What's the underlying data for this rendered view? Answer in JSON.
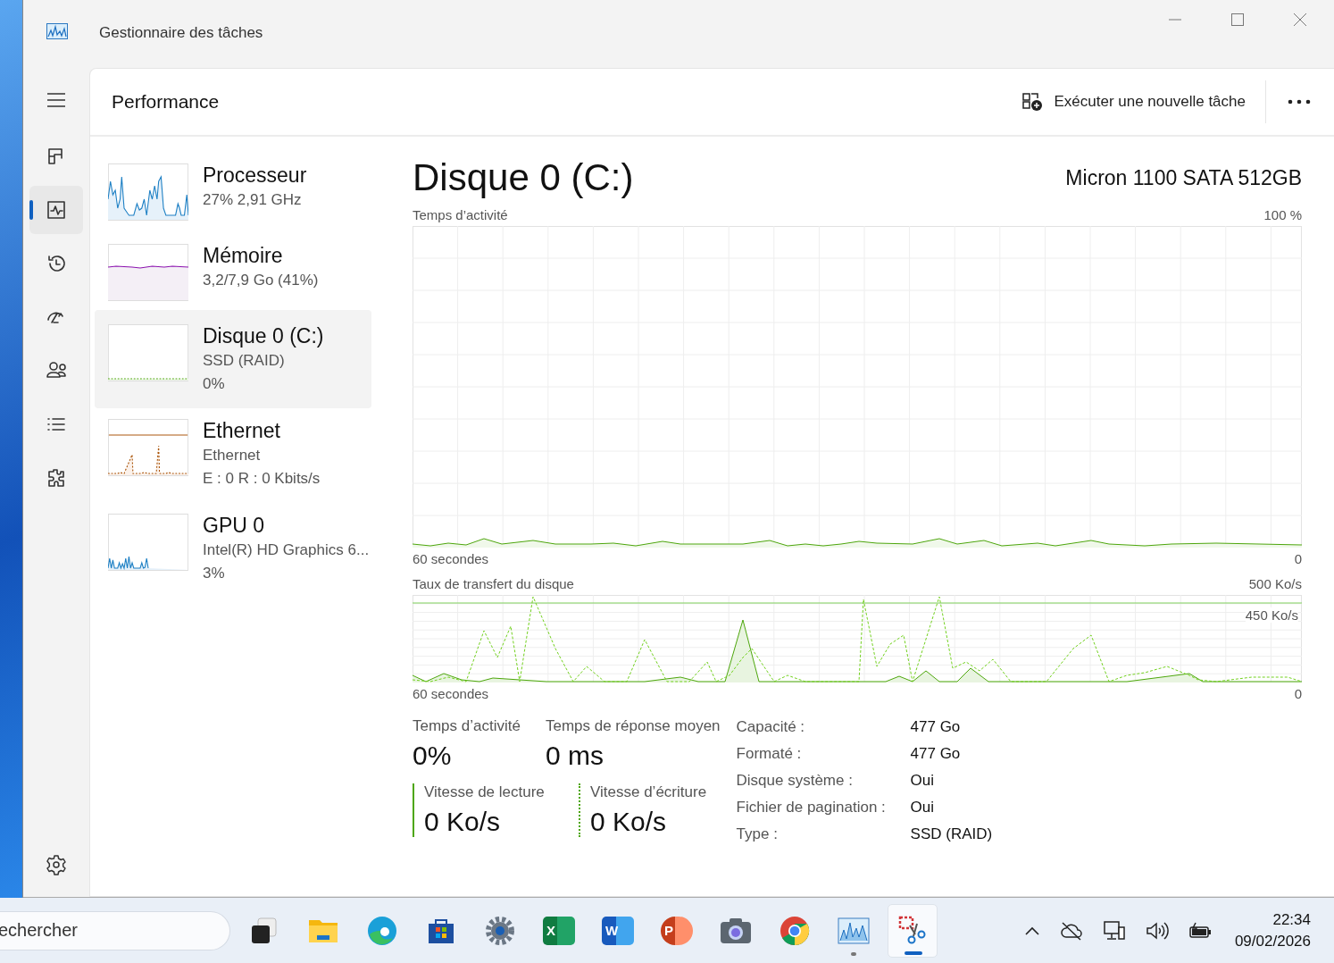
{
  "window": {
    "title": "Gestionnaire des tâches"
  },
  "nav_items": [
    {
      "kind": "processes",
      "selected": false
    },
    {
      "kind": "performance",
      "selected": true
    },
    {
      "kind": "history",
      "selected": false
    },
    {
      "kind": "startup",
      "selected": false
    },
    {
      "kind": "users",
      "selected": false
    },
    {
      "kind": "details",
      "selected": false
    },
    {
      "kind": "services",
      "selected": false
    }
  ],
  "page": {
    "title": "Performance",
    "run_task": "Exécuter une nouvelle tâche"
  },
  "resources": [
    {
      "kind": "cpu",
      "name": "Processeur",
      "lines": [
        "27%  2,91 GHz"
      ],
      "selected": false
    },
    {
      "kind": "memory",
      "name": "Mémoire",
      "lines": [
        "3,2/7,9 Go (41%)"
      ],
      "selected": false
    },
    {
      "kind": "disk",
      "name": "Disque 0 (C:)",
      "lines": [
        "SSD (RAID)",
        "0%"
      ],
      "selected": true
    },
    {
      "kind": "ethernet",
      "name": "Ethernet",
      "lines": [
        "Ethernet",
        "E : 0  R : 0 Kbits/s"
      ],
      "selected": false
    },
    {
      "kind": "gpu",
      "name": "GPU 0",
      "lines": [
        "Intel(R) HD Graphics 6...",
        "3%"
      ],
      "selected": false
    }
  ],
  "detail": {
    "title": "Disque 0 (C:)",
    "model": "Micron 1100 SATA 512GB",
    "activity_chart": {
      "label": "Temps d’activité",
      "max": "100 %",
      "x_label": "60 secondes",
      "min": "0"
    },
    "transfer_chart": {
      "label": "Taux de transfert du disque",
      "max": "500 Ko/s",
      "marker": "450 Ko/s",
      "x_label": "60 secondes",
      "min": "0"
    },
    "stats": [
      {
        "label": "Temps d’activité",
        "value": "0%"
      },
      {
        "label": "Temps de réponse moyen",
        "value": "0 ms"
      }
    ],
    "rates": [
      {
        "kind": "read",
        "label": "Vitesse de lecture",
        "value": "0 Ko/s"
      },
      {
        "kind": "write",
        "label": "Vitesse d’écriture",
        "value": "0 Ko/s"
      }
    ],
    "properties": [
      {
        "label": "Capacité :",
        "value": "477 Go"
      },
      {
        "label": "Formaté :",
        "value": "477 Go"
      },
      {
        "label": "Disque système :",
        "value": "Oui"
      },
      {
        "label": "Fichier de pagination :",
        "value": "Oui"
      },
      {
        "label": "Type :",
        "value": "SSD (RAID)"
      }
    ]
  },
  "taskbar": {
    "search": {
      "placeholder": "echercher"
    },
    "apps": [
      {
        "kind": "taskview",
        "running": false,
        "selected": false
      },
      {
        "kind": "explorer",
        "running": false,
        "selected": false
      },
      {
        "kind": "edge",
        "running": false,
        "selected": false
      },
      {
        "kind": "store",
        "running": false,
        "selected": false
      },
      {
        "kind": "settings",
        "running": false,
        "selected": false
      },
      {
        "kind": "excel",
        "glyph": "X",
        "running": false,
        "selected": false
      },
      {
        "kind": "word",
        "glyph": "W",
        "running": false,
        "selected": false
      },
      {
        "kind": "powerpoint",
        "glyph": "P",
        "running": false,
        "selected": false
      },
      {
        "kind": "camera",
        "running": false,
        "selected": false
      },
      {
        "kind": "chrome",
        "running": false,
        "selected": false
      },
      {
        "kind": "taskmanager",
        "running": true,
        "selected": false
      },
      {
        "kind": "snipping",
        "running": true,
        "selected": true
      }
    ],
    "time": "22:34",
    "date": "09/02/2026"
  }
}
